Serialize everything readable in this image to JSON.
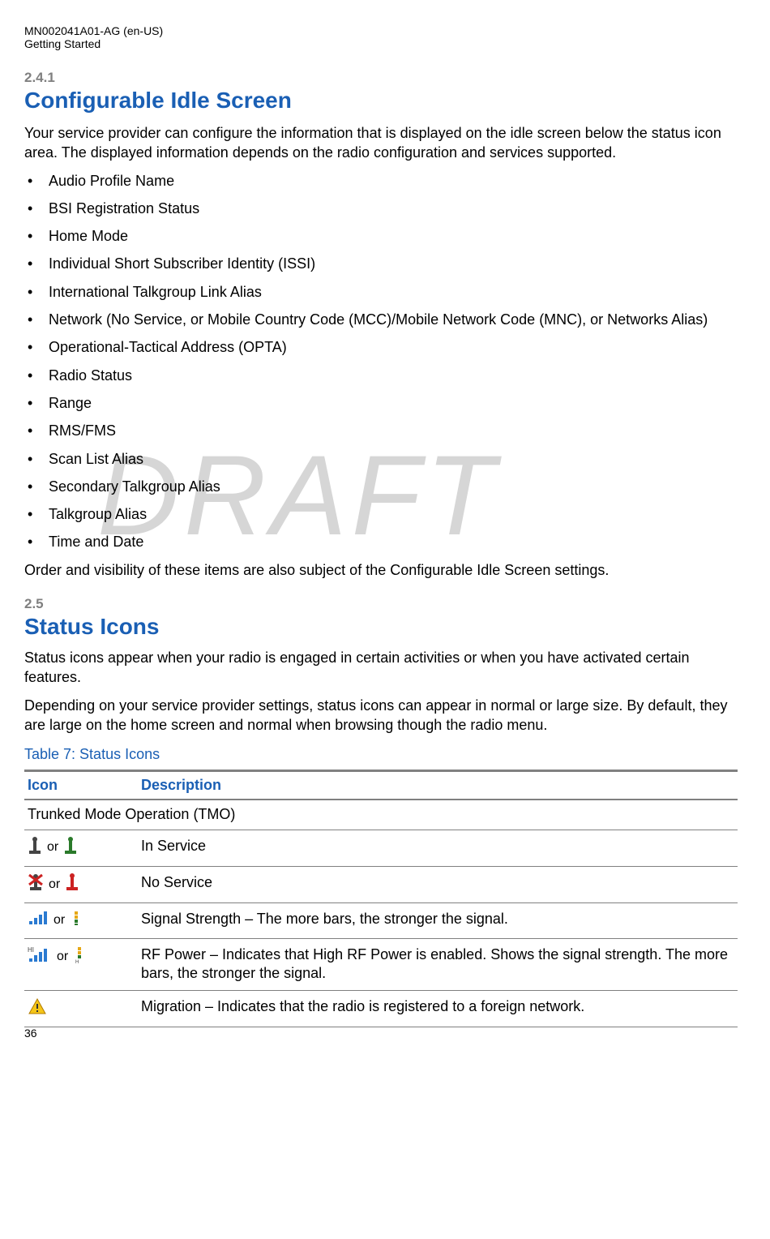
{
  "header": {
    "doc_id": "MN002041A01-AG (en-US)",
    "chapter": "Getting Started"
  },
  "section_241": {
    "num": "2.4.1",
    "title": "Configurable Idle Screen",
    "intro": "Your service provider can configure the information that is displayed on the idle screen below the status icon area. The displayed information depends on the radio configuration and services supported.",
    "items": [
      "Audio Profile Name",
      "BSI Registration Status",
      "Home Mode",
      "Individual Short Subscriber Identity (ISSI)",
      "International Talkgroup Link Alias",
      "Network (No Service, or Mobile Country Code (MCC)/Mobile Network Code (MNC), or Networks Alias)",
      "Operational-Tactical Address (OPTA)",
      "Radio Status",
      "Range",
      "RMS/FMS",
      "Scan List Alias",
      "Secondary Talkgroup Alias",
      "Talkgroup Alias",
      "Time and Date"
    ],
    "closing": "Order and visibility of these items are also subject of the Configurable Idle Screen settings."
  },
  "section_25": {
    "num": "2.5",
    "title": "Status Icons",
    "p1": "Status icons appear when your radio is engaged in certain activities or when you have activated certain features.",
    "p2": "Depending on your service provider settings, status icons can appear in normal or large size. By default, they are large on the home screen and normal when browsing though the radio menu."
  },
  "table7": {
    "caption": "Table 7: Status Icons",
    "col_icon": "Icon",
    "col_desc": "Description",
    "group": "Trunked Mode Operation (TMO)",
    "or": "or",
    "rows": [
      {
        "desc": "In Service"
      },
      {
        "desc": "No Service"
      },
      {
        "desc": "Signal Strength – The more bars, the stronger the signal."
      },
      {
        "desc": "RF Power – Indicates that High RF Power is enabled. Shows the signal strength. The more bars, the stronger the signal."
      },
      {
        "desc": "Migration – Indicates that the radio is registered to a foreign network."
      }
    ]
  },
  "watermark": "DRAFT",
  "page_number": "36"
}
